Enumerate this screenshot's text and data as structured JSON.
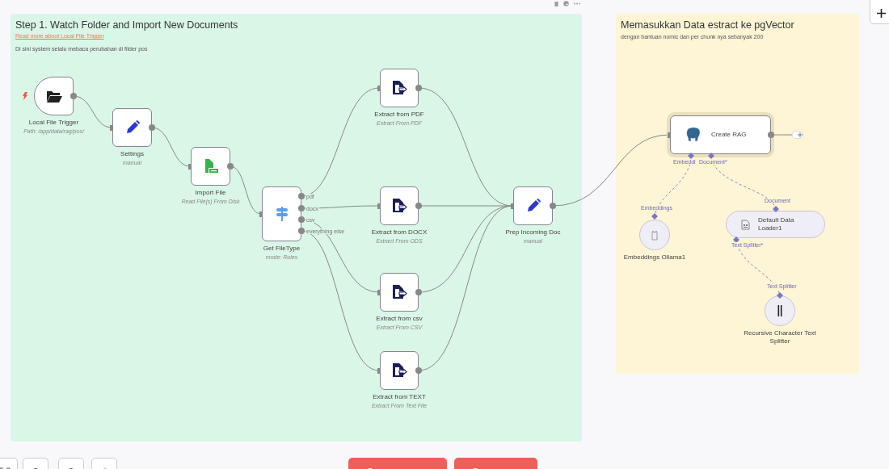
{
  "notes": [
    {
      "color": "#d9f6e7",
      "title": "Step 1. Watch Folder and Import New Documents",
      "link": "Read more about Local File Trigger",
      "text": "Di sini system selalu mebaca perubahan di filder pos"
    },
    {
      "color": "#fdf5d5",
      "title": "Memasukkan Data estract ke pgVector",
      "text": "dengan bantuan nomic dan per chunk nya sebanyak 200"
    }
  ],
  "nodes": [
    {
      "kind": "trigger",
      "title": "Local File Trigger",
      "subtitle": "Path: /app/data/rag/pos/"
    },
    {
      "kind": "action",
      "title": "Settings",
      "subtitle": "manual"
    },
    {
      "kind": "action",
      "title": "Import File",
      "subtitle": "Read File(s) From Disk"
    },
    {
      "kind": "switch",
      "title": "Get FileType",
      "subtitle": "mode: Rules",
      "ports": [
        "pdf",
        "docx",
        "csv",
        "everything else"
      ]
    },
    {
      "kind": "action",
      "title": "Extract from PDF",
      "subtitle": "Extract From PDF"
    },
    {
      "kind": "action",
      "title": "Extract from DOCX",
      "subtitle": "Extract From ODS"
    },
    {
      "kind": "action",
      "title": "Extract from csv",
      "subtitle": "Extract From CSV"
    },
    {
      "kind": "action",
      "title": "Extract from TEXT",
      "subtitle": "Extract From Text File"
    },
    {
      "kind": "action",
      "title": "Prep Incoming Doc",
      "subtitle": "manual"
    },
    {
      "kind": "wide",
      "title": "Create RAG",
      "ports": [
        "Embeddi",
        "Document*"
      ]
    },
    {
      "kind": "circle",
      "title": "Embeddings Ollama1",
      "ports": [
        "Embeddings"
      ]
    },
    {
      "kind": "pill",
      "title": "Default Data Loader1",
      "ports": [
        "Document",
        "Text Splitter*"
      ]
    },
    {
      "kind": "circle",
      "title": "Recursive Character Text Splitter",
      "ports": [
        "Text Splitter"
      ]
    }
  ]
}
